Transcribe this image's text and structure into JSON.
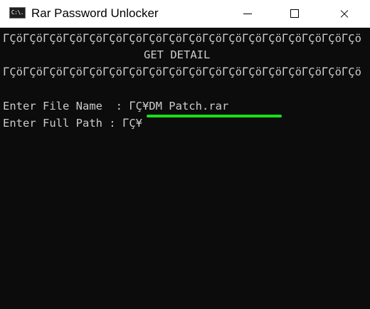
{
  "window": {
    "title": "Rar Password Unlocker",
    "icon_label": "C:\\."
  },
  "console": {
    "border_line": "ΓÇöΓÇöΓÇöΓÇöΓÇöΓÇöΓÇöΓÇöΓÇöΓÇöΓÇöΓÇöΓÇöΓÇöΓÇöΓÇöΓÇöΓÇö",
    "heading": "GET DETAIL",
    "file_name_prompt": "Enter File Name  : ",
    "file_name_value": "ΓÇ¥DM Patch.rar",
    "full_path_prompt": "Enter Full Path : ",
    "full_path_value": "ΓÇ¥"
  },
  "colors": {
    "console_background": "#0c0c0c",
    "console_text": "#cccccc",
    "highlight_underline": "#18e018"
  }
}
